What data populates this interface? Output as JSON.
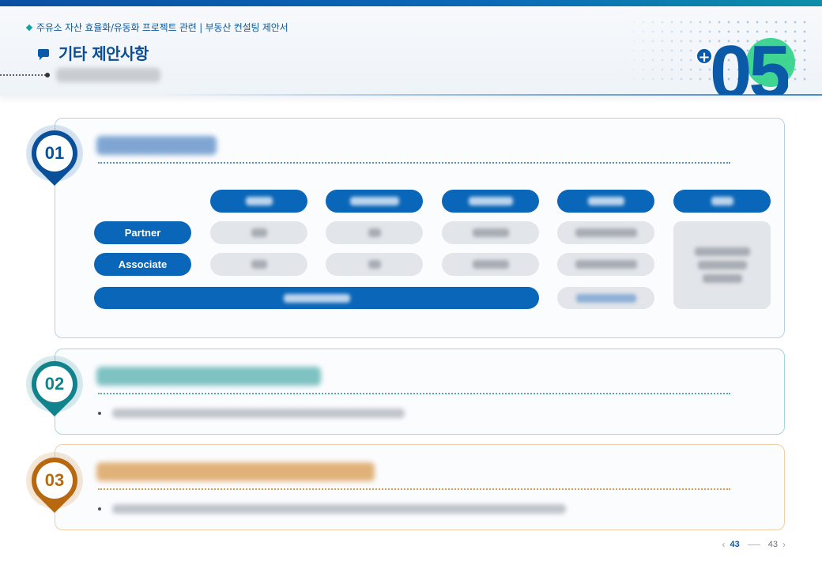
{
  "header": {
    "breadcrumb": "주유소 자산 효율화/유동화 프로젝트 관련 | 부동산 컨설팅 제안서",
    "title": "기타 제안사항",
    "section_number": "05",
    "plus_symbol": "+"
  },
  "sections": [
    {
      "number": "01",
      "color": "#0a4f99"
    },
    {
      "number": "02",
      "color": "#11838c"
    },
    {
      "number": "03",
      "color": "#b8680f"
    }
  ],
  "fee_table": {
    "row_labels": [
      "Partner",
      "Associate"
    ]
  },
  "pagination": {
    "current": "43",
    "total": "43",
    "prev_icon": "chevron-left-icon",
    "next_icon": "chevron-right-icon"
  },
  "colors": {
    "primary": "#0a5aa8",
    "accent_green": "#36d38c",
    "teal": "#11838c",
    "orange": "#b8680f"
  }
}
